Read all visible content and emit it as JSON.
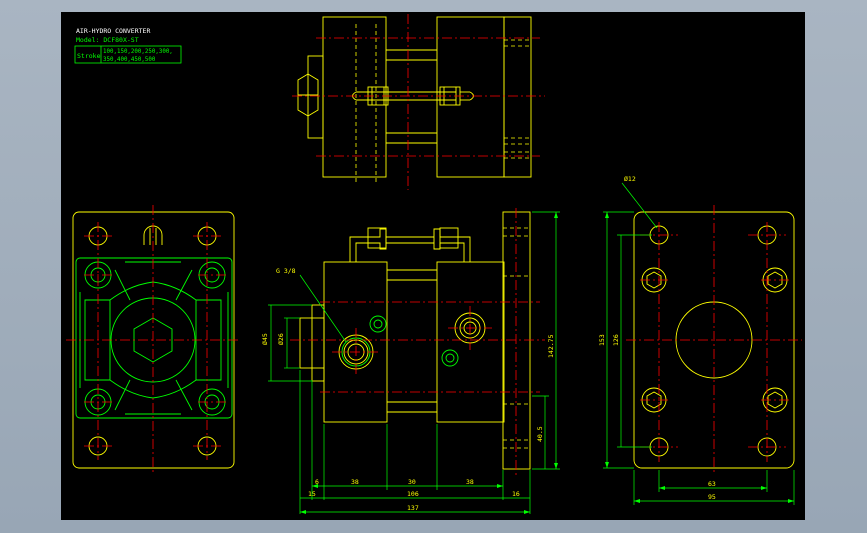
{
  "title_block": {
    "title": "AIR-HYDRO CONVERTER",
    "model": "Model: DCF80X-ST",
    "stroke_label": "Stroke",
    "stroke_line1": "100,150,200,250,300,",
    "stroke_line2": "350,400,450,500"
  },
  "dimensions": {
    "port": "G 3/8",
    "d12": "Ø12",
    "d45": "Ø45",
    "d26": "Ø26",
    "h142": "142.75",
    "h40": "40.5",
    "w153": "153",
    "w126": "126",
    "d6": "6",
    "d38a": "38",
    "d30": "30",
    "d38b": "38",
    "d15": "15",
    "d106": "106",
    "d16": "16",
    "d137": "137",
    "d63": "63",
    "d95": "95"
  },
  "colors": {
    "background": "#000000",
    "outline": "#ffff00",
    "center": "#ff0000",
    "dimension": "#00ff00",
    "frame": "#a3afbd"
  }
}
